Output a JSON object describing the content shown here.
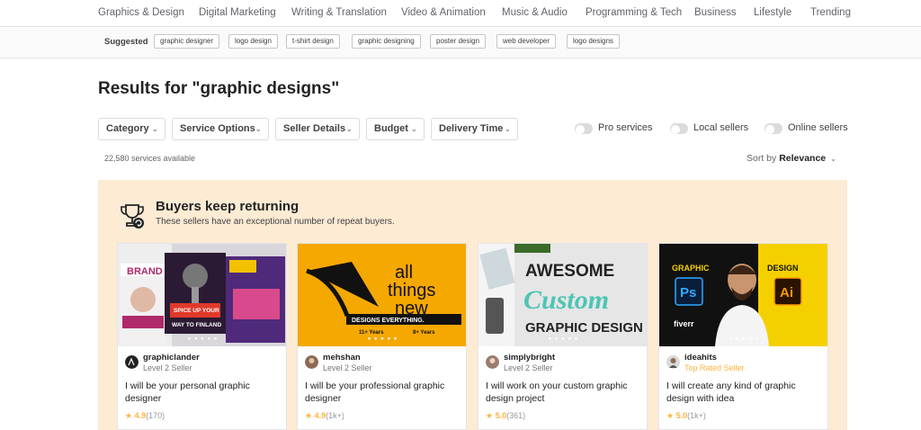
{
  "nav": {
    "categories": [
      "Graphics & Design",
      "Digital Marketing",
      "Writing & Translation",
      "Video & Animation",
      "Music & Audio",
      "Programming & Tech",
      "Business",
      "Lifestyle",
      "Trending"
    ]
  },
  "suggested": {
    "label": "Suggested",
    "chips": [
      "graphic designer",
      "logo design",
      "t-shirt design",
      "graphic designing",
      "poster design",
      "web developer",
      "logo designs"
    ]
  },
  "results": {
    "heading": "Results for \"graphic designs\"",
    "count": "22,580 services available"
  },
  "filters": [
    "Category",
    "Service Options",
    "Seller Details",
    "Budget",
    "Delivery Time"
  ],
  "toggles": [
    "Pro services",
    "Local sellers",
    "Online sellers"
  ],
  "sort": {
    "prefix": "Sort by",
    "value": "Relevance"
  },
  "panel": {
    "title": "Buyers keep returning",
    "subtitle": "These sellers have an exceptional number of repeat buyers."
  },
  "cards": [
    {
      "seller": "graphiclander",
      "level": "Level 2 Seller",
      "title": "I will be your personal graphic designer",
      "rating": "4.9",
      "reviews": "(170)",
      "thumb_text": [
        "BRAND",
        "SPICE UP YOUR",
        "WAY TO FINLAND"
      ]
    },
    {
      "seller": "mehshan",
      "level": "Level 2 Seller",
      "title": "I will be your professional graphic designer",
      "rating": "4.9",
      "reviews": "(1k+)",
      "thumb_text": [
        "all",
        "things",
        "new",
        "DESIGNS EVERYTHING.",
        "11+ Years",
        "8+ Years"
      ]
    },
    {
      "seller": "simplybright",
      "level": "Level 2 Seller",
      "title": "I will work on your custom graphic design project",
      "rating": "5.0",
      "reviews": "(361)",
      "thumb_text": [
        "AWESOME",
        "Custom",
        "GRAPHIC DESIGN"
      ]
    },
    {
      "seller": "ideahits",
      "level": "Top Rated Seller",
      "title": "I will create any kind of graphic design with idea",
      "rating": "5.0",
      "reviews": "(1k+)",
      "thumb_text": [
        "GRAPHIC",
        "Ps",
        "DESIGN",
        "Ai",
        "fiverr"
      ]
    }
  ],
  "colors": {
    "panel_bg": "#fdebd3",
    "star": "#ffb33e",
    "top_rated": "#ffb33e",
    "text_primary": "#222325",
    "text_secondary": "#62646a"
  }
}
